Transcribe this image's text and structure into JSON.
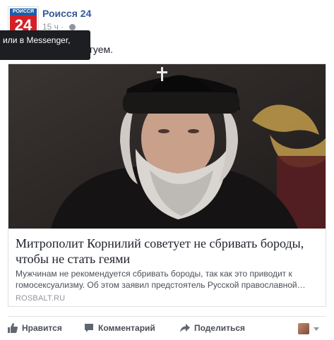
{
  "post": {
    "page_name": "Роисся 24",
    "time": "15 ч",
    "separator": "·",
    "avatar_top": "РОИССЯ",
    "avatar_main": "24",
    "text_visible": "етуем."
  },
  "tooltip": {
    "text": "или в Messenger,"
  },
  "link_card": {
    "title": "Митрополит Корнилий советует не сбривать бороды, чтобы не стать геями",
    "description": "Мужчинам не рекомендуется сбривать бороды, так как это приводит к гомосексуализму. Об этом заявил предстоятель Русской православной…",
    "domain": "ROSBALT.RU"
  },
  "actions": {
    "like_label": "Нравится",
    "comment_label": "Комментарий",
    "share_label": "Поделиться",
    "like_icon": "thumbs-up-icon",
    "comment_icon": "speech-bubble-icon",
    "share_icon": "share-arrow-icon"
  },
  "colors": {
    "link_blue": "#365899",
    "meta_gray": "#90949c",
    "tooltip_bg": "#1c1e21",
    "brand_red": "#d42027",
    "brand_blue": "#1d5ea8"
  }
}
